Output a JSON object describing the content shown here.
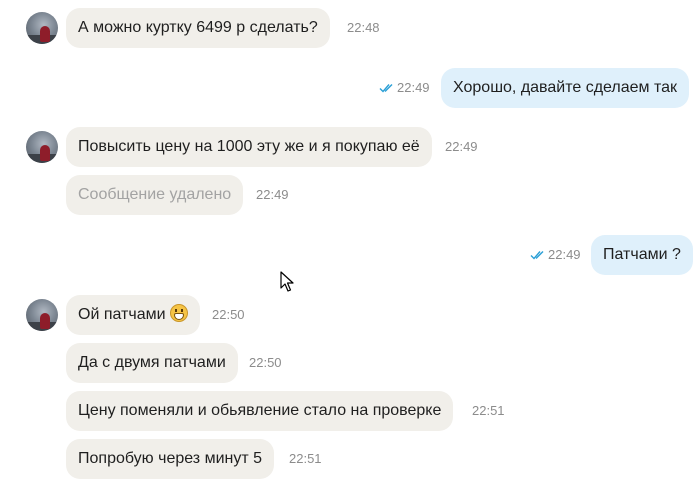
{
  "messages": [
    {
      "text": "А можно куртку 6499 р сделать?",
      "time": "22:48"
    },
    {
      "text": "Хорошо, давайте сделаем так",
      "time": "22:49"
    },
    {
      "text": "Повысить цену на 1000 эту же и я покупаю её",
      "time": "22:49"
    },
    {
      "text": "Сообщение удалено",
      "time": "22:49"
    },
    {
      "text": "Патчами ?",
      "time": "22:49"
    },
    {
      "text": "Ой патчами",
      "emoji": "grinning-face-icon",
      "time": "22:50"
    },
    {
      "text": "Да с двумя патчами",
      "time": "22:50"
    },
    {
      "text": "Цену поменяли и обьявление стало на проверке",
      "time": "22:51"
    },
    {
      "text": "Попробую через минут 5",
      "time": "22:51"
    }
  ],
  "colors": {
    "incoming_bubble": "#f1efea",
    "outgoing_bubble": "#dff0fb",
    "read_tick": "#2a9fd6",
    "time_text": "#8c8c8c",
    "deleted_text": "#a3a3a3"
  }
}
